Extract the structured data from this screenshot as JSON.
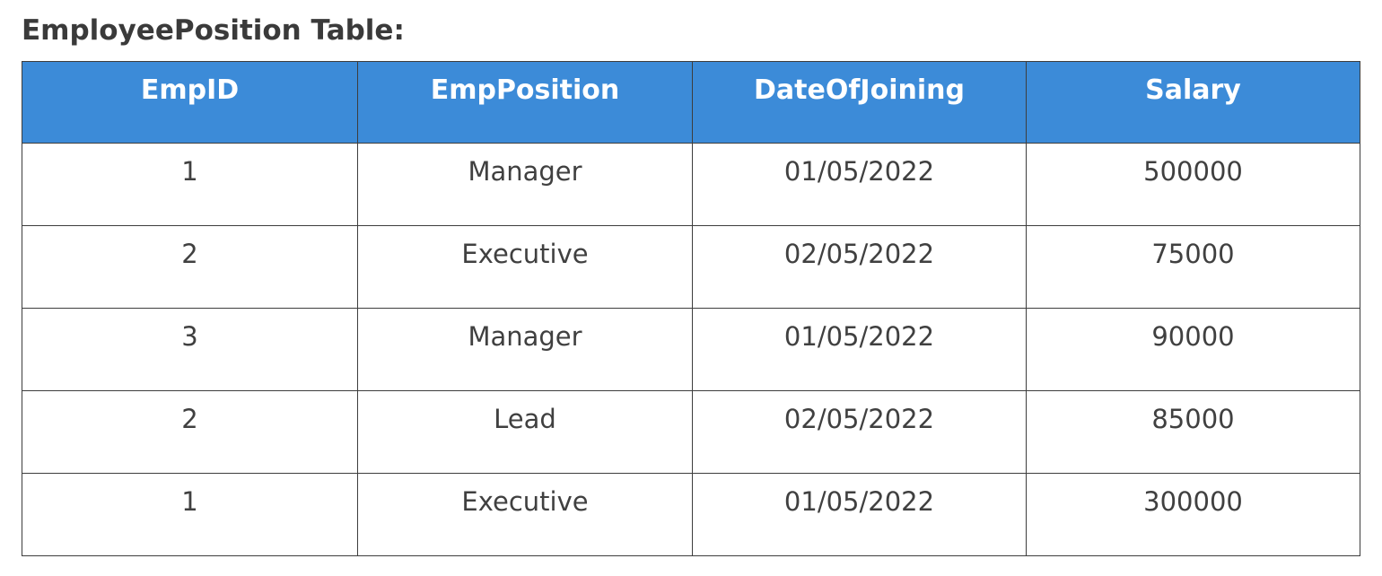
{
  "title": "EmployeePosition Table:",
  "table": {
    "headers": [
      "EmpID",
      "EmpPosition",
      "DateOfJoining",
      "Salary"
    ],
    "rows": [
      [
        "1",
        "Manager",
        "01/05/2022",
        "500000"
      ],
      [
        "2",
        "Executive",
        "02/05/2022",
        "75000"
      ],
      [
        "3",
        "Manager",
        "01/05/2022",
        "90000"
      ],
      [
        "2",
        "Lead",
        "02/05/2022",
        "85000"
      ],
      [
        "1",
        "Executive",
        "01/05/2022",
        "300000"
      ]
    ]
  },
  "colors": {
    "header_background": "#3c8bd8",
    "header_text": "#ffffff",
    "border": "#3d3d3d",
    "body_text": "#404040"
  }
}
